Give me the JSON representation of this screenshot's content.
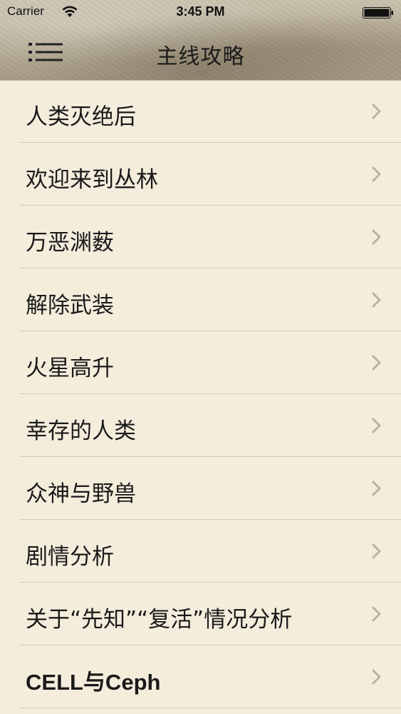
{
  "status_bar": {
    "carrier": "Carrier",
    "time": "3:45 PM",
    "wifi_icon": "wifi-icon",
    "battery_icon": "battery-icon"
  },
  "nav": {
    "title": "主线攻略",
    "menu_icon": "list-menu-icon"
  },
  "colors": {
    "background": "#f4eddc",
    "separator": "#d3cab7",
    "chevron": "#b8b2a6",
    "text": "#1a1a1a"
  },
  "items": [
    {
      "label": "人类灭绝后"
    },
    {
      "label": "欢迎来到丛林"
    },
    {
      "label": "万恶渊薮"
    },
    {
      "label": "解除武装"
    },
    {
      "label": "火星高升"
    },
    {
      "label": "幸存的人类"
    },
    {
      "label": "众神与野兽"
    },
    {
      "label": "剧情分析"
    },
    {
      "label": "关于“先知”“复活”情况分析"
    },
    {
      "label": "CELL与Ceph"
    }
  ]
}
